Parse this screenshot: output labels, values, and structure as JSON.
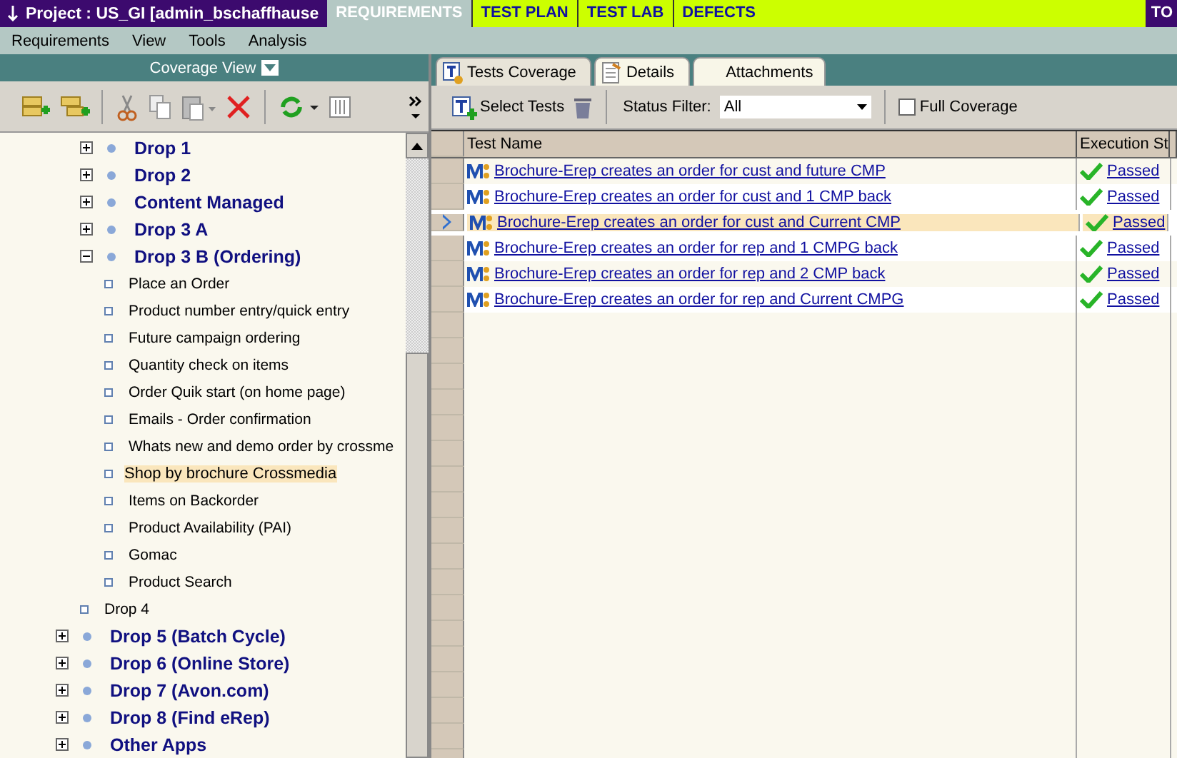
{
  "title_bar": {
    "project": "Project : US_GI [admin_bschaffhause",
    "modules": [
      {
        "label": "REQUIREMENTS",
        "selected": true
      },
      {
        "label": "TEST PLAN",
        "selected": false
      },
      {
        "label": "TEST LAB",
        "selected": false
      },
      {
        "label": "DEFECTS",
        "selected": false
      }
    ],
    "right_label": "TO"
  },
  "menu": [
    "Requirements",
    "View",
    "Tools",
    "Analysis"
  ],
  "left_panel": {
    "title": "Coverage View",
    "tree": [
      {
        "kind": "hidden",
        "children": [
          {
            "label": "Drop 1",
            "kind": "folder",
            "expanded": false
          },
          {
            "label": "Drop 2",
            "kind": "folder",
            "expanded": false
          },
          {
            "label": "Content Managed",
            "kind": "folder",
            "expanded": false
          },
          {
            "label": "Drop 3 A",
            "kind": "folder",
            "expanded": false
          },
          {
            "label": "Drop 3 B (Ordering)",
            "kind": "folder",
            "expanded": true,
            "children": [
              {
                "label": "Place an Order",
                "kind": "leaf",
                "selected": false
              },
              {
                "label": "Product number entry/quick entry",
                "kind": "leaf",
                "selected": false
              },
              {
                "label": "Future campaign ordering",
                "kind": "leaf",
                "selected": false
              },
              {
                "label": "Quantity check on items",
                "kind": "leaf",
                "selected": false
              },
              {
                "label": "Order Quik start (on home page)",
                "kind": "leaf",
                "selected": false
              },
              {
                "label": "Emails - Order confirmation",
                "kind": "leaf",
                "selected": false
              },
              {
                "label": "Whats new and demo order by crossme",
                "kind": "leaf",
                "selected": false
              },
              {
                "label": "Shop by brochure Crossmedia",
                "kind": "leaf",
                "selected": true
              },
              {
                "label": "Items on Backorder",
                "kind": "leaf",
                "selected": false
              },
              {
                "label": "Product Availability (PAI)",
                "kind": "leaf",
                "selected": false
              },
              {
                "label": "Gomac",
                "kind": "leaf",
                "selected": false
              },
              {
                "label": "Product Search",
                "kind": "leaf",
                "selected": false
              }
            ]
          },
          {
            "label": "Drop 4",
            "kind": "leaf",
            "selected": false
          }
        ]
      },
      {
        "label": "Drop 5 (Batch Cycle)",
        "kind": "folder",
        "expanded": false
      },
      {
        "label": "Drop 6 (Online Store)",
        "kind": "folder",
        "expanded": false
      },
      {
        "label": "Drop 7 (Avon.com)",
        "kind": "folder",
        "expanded": false
      },
      {
        "label": "Drop 8 (Find eRep)",
        "kind": "folder",
        "expanded": false
      },
      {
        "label": "Other Apps",
        "kind": "folder",
        "expanded": false
      }
    ]
  },
  "right_panel": {
    "tabs": [
      {
        "label": "Tests Coverage",
        "selected": true
      },
      {
        "label": "Details",
        "selected": false
      },
      {
        "label": "Attachments",
        "selected": false
      }
    ],
    "select_tests": "Select Tests",
    "status_filter_label": "Status Filter:",
    "status_filter_value": "All",
    "full_coverage": {
      "label": "Full Coverage",
      "checked": false
    },
    "table": {
      "columns": [
        "Test Name",
        "Execution St"
      ],
      "rows": [
        {
          "name": "Brochure-Erep creates an order for cust  and future CMP",
          "status": "Passed",
          "selected": false
        },
        {
          "name": "Brochure-Erep creates an order for cust and 1 CMP back",
          "status": "Passed",
          "selected": false
        },
        {
          "name": "Brochure-Erep creates an order for cust and Current CMP",
          "status": "Passed",
          "selected": true
        },
        {
          "name": "Brochure-Erep creates an order for rep and 1 CMPG back",
          "status": "Passed",
          "selected": false
        },
        {
          "name": "Brochure-Erep creates an order for rep and 2 CMP back",
          "status": "Passed",
          "selected": false
        },
        {
          "name": "Brochure-Erep creates an order for rep and Current CMPG",
          "status": "Passed",
          "selected": false
        }
      ]
    }
  }
}
